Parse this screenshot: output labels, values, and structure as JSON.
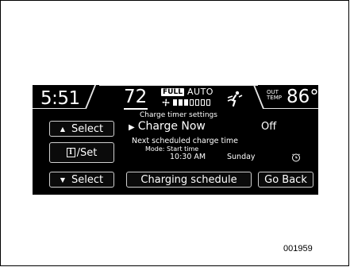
{
  "status_bar": {
    "clock": "5:51",
    "set_temperature": "72",
    "fan_mode_badge": "FULL",
    "climate_mode": "AUTO",
    "fan_level": 3,
    "fan_level_max": 7,
    "outside_label_line1": "OUT",
    "outside_label_line2": "TEMP",
    "outside_temperature": "86°F"
  },
  "left_buttons": {
    "select_up": "Select",
    "info_set_icon": "i",
    "info_set_label": "/Set",
    "select_down": "Select"
  },
  "panel": {
    "heading": "Charge timer settings",
    "charge_now_label": "Charge Now",
    "charge_now_state": "Off",
    "next_schedule_label": "Next scheduled charge time",
    "mode_label": "Mode: Start time",
    "scheduled_time": "10:30 AM",
    "scheduled_day": "Sunday"
  },
  "bottom_buttons": {
    "charging_schedule": "Charging schedule",
    "go_back": "Go Back"
  },
  "figure_number": "001959",
  "colors": {
    "screen_background": "#000000",
    "text": "#ffffff",
    "button_border": "#cfcfcf"
  },
  "icons": [
    "up-triangle-icon",
    "info-icon",
    "down-triangle-icon",
    "fan-icon",
    "airflow-icon",
    "play-icon",
    "clock-icon"
  ]
}
